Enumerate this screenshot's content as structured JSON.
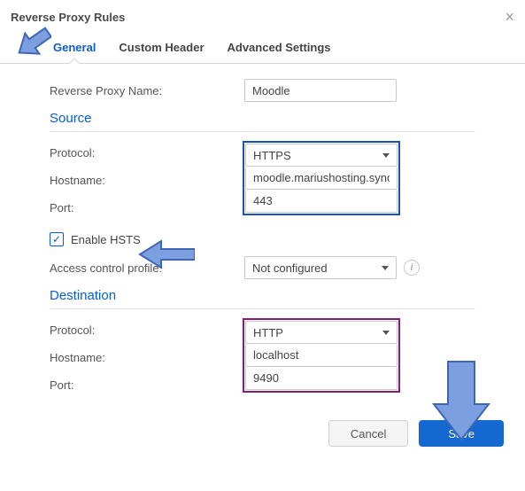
{
  "dialog": {
    "title": "Reverse Proxy Rules"
  },
  "tabs": {
    "general": "General",
    "custom_header": "Custom Header",
    "advanced": "Advanced Settings"
  },
  "fields": {
    "name_label": "Reverse Proxy Name:",
    "name_value": "Moodle",
    "source_title": "Source",
    "protocol_label": "Protocol:",
    "hostname_label": "Hostname:",
    "port_label": "Port:",
    "source": {
      "protocol": "HTTPS",
      "hostname": "moodle.mariushosting.synology.me",
      "port": "443"
    },
    "enable_hsts_label": "Enable HSTS",
    "enable_hsts_checked": true,
    "acp_label": "Access control profile:",
    "acp_value": "Not configured",
    "destination_title": "Destination",
    "destination": {
      "protocol": "HTTP",
      "hostname": "localhost",
      "port": "9490"
    }
  },
  "buttons": {
    "cancel": "Cancel",
    "save": "Save"
  },
  "colors": {
    "accent": "#0a5ecb",
    "group_source": "#1651c6",
    "group_dest": "#8a1a7a",
    "arrow_fill": "#7c9fe0",
    "arrow_stroke": "#3f66b5"
  }
}
